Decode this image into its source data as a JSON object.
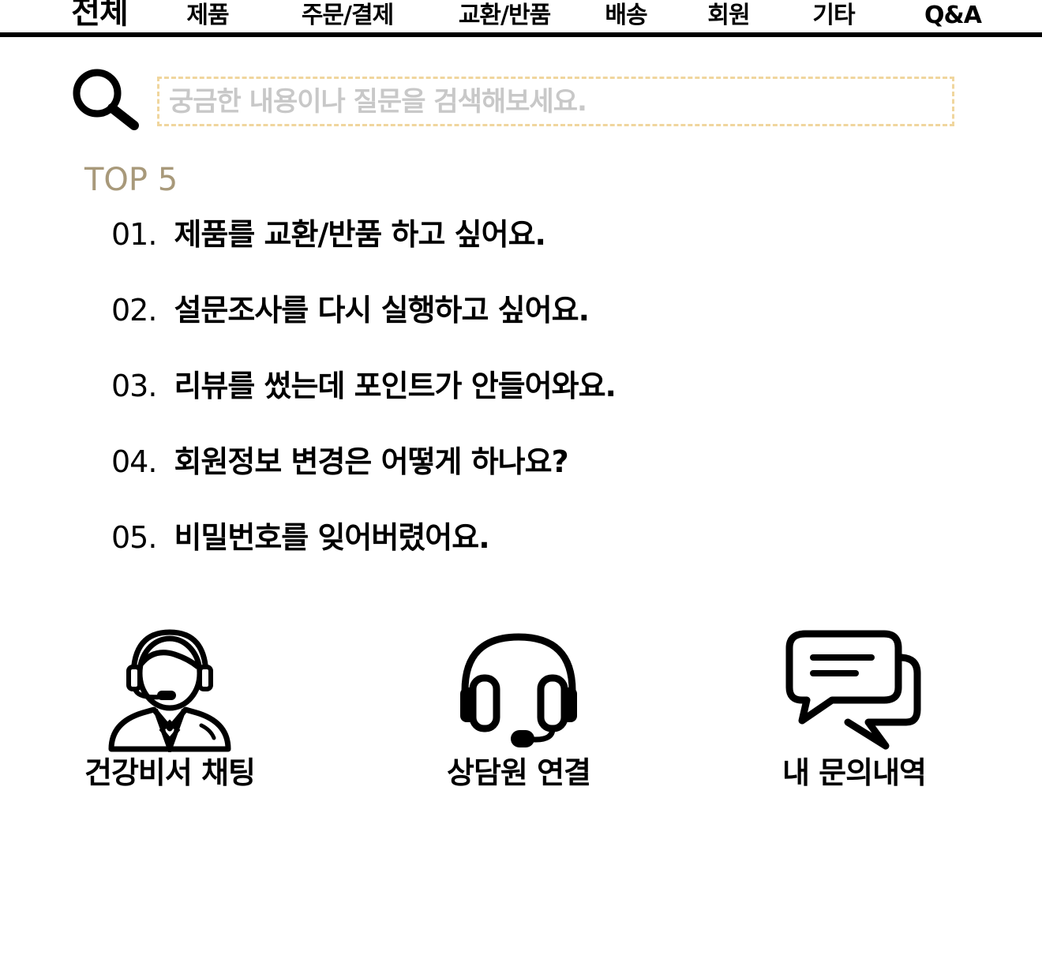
{
  "nav": {
    "tabs": [
      {
        "label": "전체",
        "active": true
      },
      {
        "label": "제품",
        "active": false
      },
      {
        "label": "주문/결제",
        "active": false
      },
      {
        "label": "교환/반품",
        "active": false
      },
      {
        "label": "배송",
        "active": false
      },
      {
        "label": "회원",
        "active": false
      },
      {
        "label": "기타",
        "active": false
      },
      {
        "label": "Q&A",
        "active": false
      }
    ]
  },
  "search": {
    "placeholder": "궁금한 내용이나 질문을 검색해보세요.",
    "value": "",
    "icon": "search-icon"
  },
  "top5": {
    "title": "TOP 5",
    "items": [
      {
        "num": "01.",
        "text": "제품를 교환/반품 하고 싶어요."
      },
      {
        "num": "02.",
        "text": "설문조사를 다시 실행하고 싶어요."
      },
      {
        "num": "03.",
        "text": "리뷰를 썼는데 포인트가 안들어와요."
      },
      {
        "num": "04.",
        "text": "회원정보 변경은 어떻게 하나요?"
      },
      {
        "num": "05.",
        "text": "비밀번호를 잊어버렸어요."
      }
    ]
  },
  "actions": {
    "chat": {
      "label": "건강비서 채팅",
      "icon": "support-agent-icon"
    },
    "agent": {
      "label": "상담원 연결",
      "icon": "headset-icon"
    },
    "history": {
      "label": "내 문의내역",
      "icon": "chat-bubbles-icon"
    }
  },
  "colors": {
    "accent_title": "#a8997a",
    "search_border": "#f0d69e",
    "placeholder": "#c8c8c8",
    "text": "#000000"
  }
}
